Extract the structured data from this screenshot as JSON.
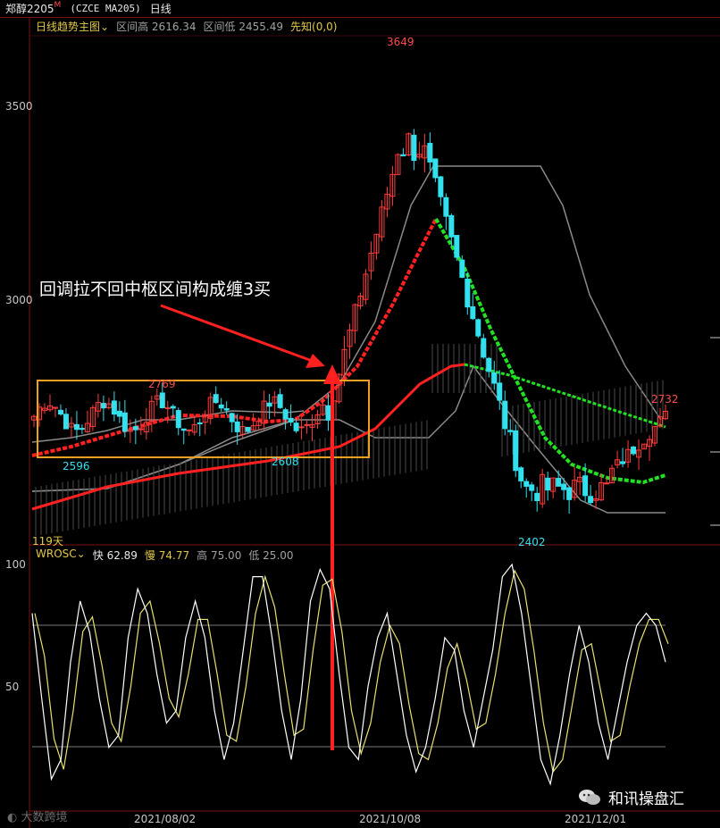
{
  "title_bar": {
    "symbol": "郑醇2205",
    "flag": "M",
    "code": "(CZCE MA205)",
    "period": "日线"
  },
  "main_chart": {
    "indicator_name": "日线趋势主图",
    "range_high_label": "区间高",
    "range_high": "2616.34",
    "range_low_label": "区间低",
    "range_low": "2455.49",
    "signal": "先知(0,0)",
    "y_ticks": [
      "3500",
      "3000"
    ],
    "days_label": "119天",
    "annotation": "回调拉不回中枢区间构成缠3买",
    "price_labels": {
      "peak_high": "3649",
      "box_high": "2769",
      "box_low": "2596",
      "box_low2": "2608",
      "right_high": "2732",
      "final_low": "2402"
    }
  },
  "sub_chart": {
    "indicator_name": "WROSC",
    "fast_label": "快",
    "fast_value": "62.89",
    "slow_label": "慢",
    "slow_value": "74.77",
    "high_label": "高",
    "high_value": "75.00",
    "low_label": "低",
    "low_value": "25.00",
    "y_ticks": [
      "100",
      "50"
    ]
  },
  "x_axis_dates": [
    "2021/08/02",
    "2021/10/08",
    "2021/12/01"
  ],
  "watermarks": {
    "left": "大数跨境",
    "right": "和讯操盘汇"
  },
  "colors": {
    "up": "#ff3b3b",
    "down": "#33e0ee",
    "box": "#f0a020",
    "trend_up": "#ff2020",
    "trend_down": "#22e022",
    "osc_fast": "#ffffff",
    "osc_slow": "#e8e070"
  },
  "chart_data": {
    "type": "candlestick",
    "y_range": [
      2330,
      3700
    ],
    "osc_range": [
      0,
      100
    ],
    "osc_fast": [
      80,
      45,
      12,
      20,
      60,
      85,
      72,
      45,
      25,
      30,
      70,
      90,
      80,
      55,
      35,
      40,
      70,
      85,
      70,
      40,
      20,
      35,
      65,
      95,
      95,
      70,
      40,
      20,
      45,
      85,
      98,
      90,
      55,
      25,
      20,
      50,
      70,
      80,
      55,
      30,
      15,
      25,
      45,
      70,
      65,
      40,
      25,
      45,
      65,
      95,
      100,
      80,
      50,
      20,
      10,
      30,
      55,
      75,
      60,
      35,
      20,
      40,
      60,
      75,
      80,
      75,
      60
    ]
  }
}
